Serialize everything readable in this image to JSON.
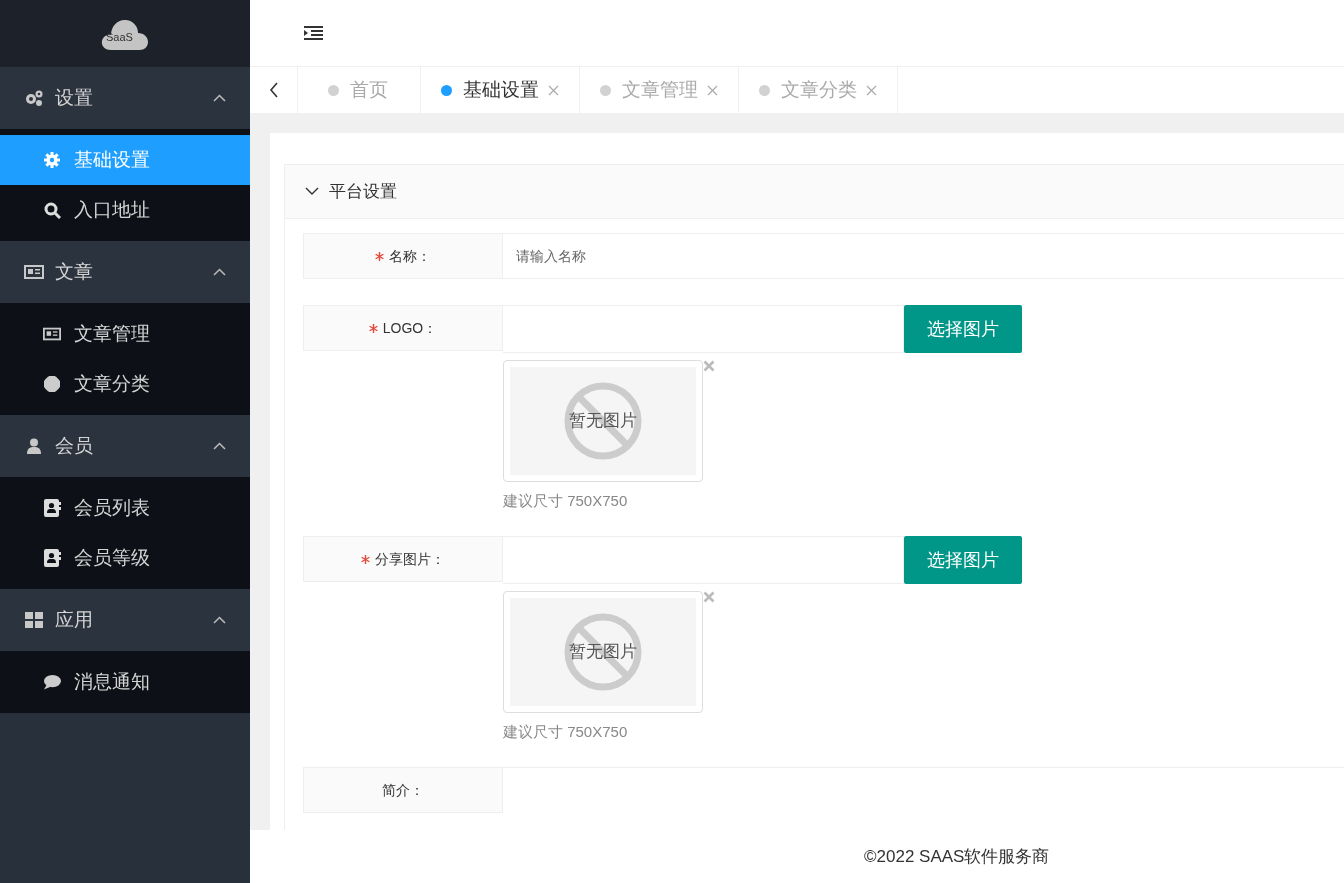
{
  "logo": {
    "text": "SaaS"
  },
  "sidebar": {
    "groups": [
      {
        "label": "设置",
        "kind": "settings",
        "expanded": true,
        "items": [
          {
            "label": "基础设置",
            "kind": "gear",
            "selected": true
          },
          {
            "label": "入口地址",
            "kind": "search",
            "selected": false
          }
        ]
      },
      {
        "label": "文章",
        "kind": "article",
        "expanded": true,
        "items": [
          {
            "label": "文章管理",
            "kind": "article",
            "selected": false
          },
          {
            "label": "文章分类",
            "kind": "badge",
            "selected": false
          }
        ]
      },
      {
        "label": "会员",
        "kind": "member",
        "expanded": true,
        "items": [
          {
            "label": "会员列表",
            "kind": "contact",
            "selected": false
          },
          {
            "label": "会员等级",
            "kind": "contact",
            "selected": false
          }
        ]
      },
      {
        "label": "应用",
        "kind": "app",
        "expanded": true,
        "items": [
          {
            "label": "消息通知",
            "kind": "chat",
            "selected": false
          }
        ]
      }
    ]
  },
  "tabs": [
    {
      "label": "首页",
      "selected": false,
      "closable": false
    },
    {
      "label": "基础设置",
      "selected": true,
      "closable": true
    },
    {
      "label": "文章管理",
      "selected": false,
      "closable": true
    },
    {
      "label": "文章分类",
      "selected": false,
      "closable": true
    }
  ],
  "panel": {
    "title": "平台设置",
    "expanded": true,
    "fields": [
      {
        "kind": "text",
        "label": "名称：",
        "required": true,
        "placeholder": "请输入名称"
      },
      {
        "kind": "image",
        "label": "LOGO：",
        "required": true,
        "button": "选择图片",
        "empty_text": "暂无图片",
        "hint": "建议尺寸 750X750"
      },
      {
        "kind": "image",
        "label": "分享图片：",
        "required": true,
        "button": "选择图片",
        "empty_text": "暂无图片",
        "hint": "建议尺寸 750X750"
      },
      {
        "kind": "textarea",
        "label": "简介：",
        "required": false
      }
    ]
  },
  "footer": {
    "text": "©2022 SAAS软件服务商"
  }
}
